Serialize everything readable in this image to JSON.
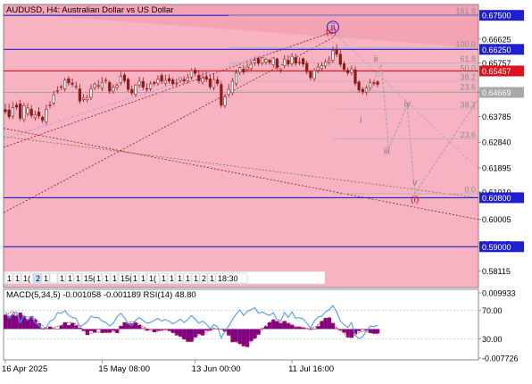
{
  "window": {
    "symbol_title": "AUDUSD, H4:  Australian Dollar vs US Dollar"
  },
  "colors": {
    "background": "#ffffff",
    "chart_area": "#f7b3c1",
    "channel_band": "#f4a3b4",
    "blue_line": "#1f1fd1",
    "red_line": "#e0111d",
    "candle": "#8b1a1a",
    "price_label_blue": "#1f1fd1",
    "price_label_red": "#e0111d",
    "price_label_grey": "#a8a8a8",
    "macd_hist": "#800080",
    "macd_signal": "#5599ee",
    "fib_text": "#8a8a8a",
    "wave_text": "#7a7a7a",
    "wave_blue": "#1f1fd1",
    "wave_red": "#e0111d",
    "projection": "#9f9fe6"
  },
  "chart_data": [
    {
      "type": "candlestick",
      "title": "AUDUSD, H4:  Australian Dollar vs US Dollar",
      "ylim": [
        0.575,
        0.679
      ],
      "y_ticks": [
        "0.66625",
        "0.65757",
        "0.64669",
        "0.63785",
        "0.62840",
        "0.61895",
        "0.61010",
        "0.60005",
        "0.59115",
        "0.58115"
      ],
      "x_tick_labels": [
        "16 Apr 2025",
        "15 May 08:00",
        "13 Jun 00:00",
        "11 Jul 16:00"
      ],
      "price_levels": [
        {
          "price": 0.675,
          "label": "0.67500",
          "style": "blue"
        },
        {
          "price": 0.6625,
          "label": "0.66250",
          "style": "blue"
        },
        {
          "price": 0.65457,
          "label": "0.65457",
          "style": "red"
        },
        {
          "price": 0.64669,
          "label": "0.64669",
          "style": "grey"
        },
        {
          "price": 0.608,
          "label": "0.60800",
          "style": "blue"
        },
        {
          "price": 0.59,
          "label": "0.59000",
          "style": "blue"
        }
      ],
      "fib_levels": [
        {
          "label": "161.8",
          "price": 0.675
        },
        {
          "label": "100.0",
          "price": 0.663
        },
        {
          "label": "61.8",
          "price": 0.6575
        },
        {
          "label": "50.0",
          "price": 0.654
        },
        {
          "label": "38.2",
          "price": 0.6508
        },
        {
          "label": "23.6",
          "price": 0.6472
        },
        {
          "label": "38.2",
          "price": 0.6406
        },
        {
          "label": "23.6",
          "price": 0.6297
        },
        {
          "label": "0.0",
          "price": 0.6095
        }
      ],
      "wave_labels": [
        {
          "text": "ii",
          "style": "circled-blue",
          "x": 88,
          "price": 0.6697
        },
        {
          "text": "(c)",
          "style": "red",
          "x": 87.5,
          "price": 0.668
        },
        {
          "text": "ii",
          "style": "grey",
          "x": 99.5,
          "price": 0.6578
        },
        {
          "text": "i",
          "style": "grey",
          "x": 95.5,
          "price": 0.6355
        },
        {
          "text": "iv",
          "style": "grey",
          "x": 108,
          "price": 0.6415
        },
        {
          "text": "iii",
          "style": "grey",
          "x": 102.5,
          "price": 0.624
        },
        {
          "text": "v",
          "style": "grey",
          "x": 110,
          "price": 0.6125
        },
        {
          "text": "(i)",
          "style": "red",
          "x": 110,
          "price": 0.6064
        }
      ],
      "wave_projection": [
        {
          "x": 97,
          "price": 0.645
        },
        {
          "x": 101,
          "price": 0.657
        },
        {
          "x": 103,
          "price": 0.626
        },
        {
          "x": 108,
          "price": 0.642
        },
        {
          "x": 110,
          "price": 0.6095
        },
        {
          "x": 127,
          "price": 0.644
        }
      ],
      "candles": [
        [
          0.6404,
          0.6396,
          0.6425
        ],
        [
          0.6402,
          0.6378,
          0.6425
        ],
        [
          0.638,
          0.6411,
          0.6432
        ],
        [
          0.642,
          0.6413,
          0.643
        ],
        [
          0.6425,
          0.6372,
          0.644
        ],
        [
          0.6368,
          0.6418,
          0.6428
        ],
        [
          0.639,
          0.6409,
          0.6427
        ],
        [
          0.6405,
          0.6382,
          0.642
        ],
        [
          0.6374,
          0.6385,
          0.64
        ],
        [
          0.6395,
          0.638,
          0.6413
        ],
        [
          0.6376,
          0.6364,
          0.6382
        ],
        [
          0.6358,
          0.6405,
          0.6422
        ],
        [
          0.6418,
          0.6421,
          0.6435
        ],
        [
          0.6428,
          0.6458,
          0.6473
        ],
        [
          0.6472,
          0.6474,
          0.649
        ],
        [
          0.6486,
          0.6488,
          0.6495
        ],
        [
          0.648,
          0.6512,
          0.652
        ],
        [
          0.6517,
          0.6502,
          0.6526
        ],
        [
          0.6501,
          0.6497,
          0.6518
        ],
        [
          0.6488,
          0.6489,
          0.6507
        ],
        [
          0.648,
          0.6435,
          0.6497
        ],
        [
          0.6441,
          0.6448,
          0.646
        ],
        [
          0.644,
          0.6448,
          0.6458
        ],
        [
          0.6449,
          0.6481,
          0.6496
        ],
        [
          0.6485,
          0.6497,
          0.6504
        ],
        [
          0.649,
          0.6493,
          0.6513
        ],
        [
          0.6482,
          0.6504,
          0.6523
        ],
        [
          0.651,
          0.6513,
          0.6521
        ],
        [
          0.6503,
          0.6472,
          0.6511
        ],
        [
          0.6472,
          0.6485,
          0.6497
        ],
        [
          0.6486,
          0.6493,
          0.6501
        ],
        [
          0.6503,
          0.6525,
          0.6543
        ],
        [
          0.6531,
          0.651,
          0.6539
        ],
        [
          0.6515,
          0.6478,
          0.6522
        ],
        [
          0.6478,
          0.6465,
          0.6491
        ],
        [
          0.646,
          0.6494,
          0.65
        ],
        [
          0.6494,
          0.6508,
          0.6524
        ],
        [
          0.6507,
          0.6486,
          0.6522
        ],
        [
          0.6481,
          0.6479,
          0.65
        ],
        [
          0.6481,
          0.6498,
          0.6508
        ],
        [
          0.6504,
          0.65,
          0.651
        ],
        [
          0.6501,
          0.6515,
          0.6529
        ],
        [
          0.6529,
          0.6508,
          0.6538
        ],
        [
          0.6501,
          0.6511,
          0.6532
        ],
        [
          0.6518,
          0.6509,
          0.6533
        ],
        [
          0.6513,
          0.6499,
          0.6522
        ],
        [
          0.6498,
          0.6501,
          0.6518
        ],
        [
          0.6511,
          0.6521,
          0.6522
        ],
        [
          0.6514,
          0.6509,
          0.6526
        ],
        [
          0.651,
          0.6521,
          0.6536
        ],
        [
          0.6523,
          0.6547,
          0.6556
        ],
        [
          0.6549,
          0.6537,
          0.6558
        ],
        [
          0.653,
          0.6509,
          0.6549
        ],
        [
          0.6505,
          0.652,
          0.6542
        ],
        [
          0.6524,
          0.6515,
          0.6543
        ],
        [
          0.6517,
          0.6487,
          0.6533
        ],
        [
          0.6484,
          0.6514,
          0.6536
        ],
        [
          0.6513,
          0.65,
          0.6526
        ],
        [
          0.6496,
          0.642,
          0.6509
        ],
        [
          0.6419,
          0.645,
          0.6459
        ],
        [
          0.6459,
          0.6478,
          0.6497
        ],
        [
          0.6466,
          0.6508,
          0.652
        ],
        [
          0.65,
          0.6538,
          0.6551
        ],
        [
          0.6541,
          0.6558,
          0.6562
        ],
        [
          0.6552,
          0.6542,
          0.6567
        ],
        [
          0.6552,
          0.6559,
          0.6573
        ],
        [
          0.6554,
          0.657,
          0.6581
        ],
        [
          0.6575,
          0.6585,
          0.6598
        ],
        [
          0.6591,
          0.6574,
          0.6599
        ],
        [
          0.6575,
          0.6594,
          0.6597
        ],
        [
          0.6578,
          0.6589,
          0.6594
        ],
        [
          0.6585,
          0.6578,
          0.6592
        ],
        [
          0.6568,
          0.6593,
          0.6597
        ],
        [
          0.659,
          0.6559,
          0.6594
        ],
        [
          0.6549,
          0.6554,
          0.6556
        ],
        [
          0.6565,
          0.6589,
          0.6604
        ],
        [
          0.6585,
          0.6571,
          0.6604
        ],
        [
          0.6573,
          0.6599,
          0.6612
        ],
        [
          0.6595,
          0.6574,
          0.661
        ],
        [
          0.6577,
          0.6578,
          0.6595
        ],
        [
          0.6591,
          0.6571,
          0.6595
        ],
        [
          0.6573,
          0.6543,
          0.6584
        ],
        [
          0.6543,
          0.6521,
          0.6548
        ],
        [
          0.6518,
          0.6547,
          0.6556
        ],
        [
          0.6548,
          0.656,
          0.6575
        ],
        [
          0.6554,
          0.6565,
          0.6578
        ],
        [
          0.6564,
          0.6579,
          0.6588
        ],
        [
          0.6578,
          0.6586,
          0.66
        ],
        [
          0.6586,
          0.662,
          0.6636
        ],
        [
          0.6624,
          0.6607,
          0.6644
        ],
        [
          0.6607,
          0.657,
          0.6622
        ],
        [
          0.6572,
          0.6552,
          0.6582
        ],
        [
          0.6548,
          0.6539,
          0.6558
        ],
        [
          0.654,
          0.6553,
          0.6566
        ],
        [
          0.655,
          0.65,
          0.6563
        ],
        [
          0.6505,
          0.6476,
          0.6511
        ],
        [
          0.6478,
          0.6469,
          0.6487
        ],
        [
          0.6468,
          0.6484,
          0.6493
        ],
        [
          0.6483,
          0.6502,
          0.6516
        ],
        [
          0.6503,
          0.65,
          0.6512
        ],
        [
          0.6505,
          0.6496,
          0.6511
        ]
      ]
    },
    {
      "type": "oscillator",
      "title": "MACD(5,34,5) -0.001058 -0.001189 RSI(14) 48.80",
      "y_ticks": [
        "0.009933",
        "70.00",
        "30.00",
        "-0.007726"
      ],
      "rsi_levels": [
        70,
        30
      ],
      "macd_range": [
        -0.007726,
        0.009933
      ],
      "macd": [
        0.0036,
        0.0033,
        0.0036,
        0.0033,
        0.0041,
        0.0033,
        0.0025,
        0.0032,
        0.0024,
        0.0014,
        0.0,
        0.0002,
        0.0006,
        0.0002,
        0.0001,
        0.0009,
        0.0017,
        0.001,
        0.0015,
        0.0009,
        0.0003,
        -0.0005,
        -0.0015,
        -0.0005,
        -0.0008,
        -0.0001,
        -0.001,
        -0.0009,
        -0.0009,
        -0.0004,
        -0.001,
        0.0008,
        0.0017,
        0.0014,
        0.0014,
        0.0016,
        0.001,
        0.0002,
        -0.0004,
        -0.0001,
        -0.0008,
        -0.0004,
        -0.0003,
        -0.0,
        -0.0005,
        -0.001,
        -0.0016,
        -0.0019,
        -0.0026,
        -0.0032,
        -0.0032,
        -0.0021,
        -0.0013,
        -0.0016,
        -0.0004,
        -0.0004,
        0.0002,
        0.0001,
        0.0,
        -0.0006,
        -0.0016,
        -0.0033,
        -0.0032,
        -0.0037,
        -0.0043,
        -0.0045,
        -0.003,
        -0.0024,
        -0.0014,
        0.0002,
        0.0007,
        0.0017,
        0.0024,
        0.0019,
        0.0015,
        0.002,
        0.0015,
        0.0011,
        0.0005,
        0.0006,
        0.0004,
        0.0002,
        -0.0002,
        0.0001,
        0.0007,
        0.002,
        0.0028,
        0.0029,
        0.0015,
        0.0002,
        -0.0003,
        -0.0009,
        -0.0021,
        -0.0022,
        -0.0012,
        -0.0005,
        -0.0001,
        -0.0004,
        -0.001,
        -0.0011,
        -0.0011
      ],
      "signal": [
        0.0034,
        0.004,
        0.0044,
        0.0034,
        0.0036,
        0.0032,
        0.003,
        0.0028,
        0.0026,
        0.0018,
        0.0008,
        0.0002,
        0.0,
        0.0004,
        0.0007,
        0.0009,
        0.0014,
        0.0017,
        0.0016,
        0.0012,
        0.0006,
        -0.0003,
        -0.001,
        -0.0011,
        -0.0009,
        -0.0008,
        -0.0007,
        -0.0009,
        -0.0009,
        -0.0007,
        -0.0003,
        0.0003,
        0.0012,
        0.0016,
        0.0019,
        0.0017,
        0.0012,
        0.0006,
        0.0001,
        -0.0003,
        -0.0006,
        -0.0006,
        -0.0004,
        -0.0002,
        -0.0003,
        -0.0007,
        -0.0012,
        -0.0019,
        -0.0025,
        -0.003,
        -0.0029,
        -0.0022,
        -0.0014,
        -0.0011,
        -0.0007,
        -0.0002,
        0.0001,
        0.0001,
        -0.0001,
        -0.0006,
        -0.0014,
        -0.0025,
        -0.0033,
        -0.0038,
        -0.0042,
        -0.0039,
        -0.0031,
        -0.0024,
        -0.0013,
        -0.0002,
        0.0009,
        0.0017,
        0.0021,
        0.002,
        0.0018,
        0.0016,
        0.0013,
        0.0009,
        0.0006,
        0.0005,
        0.0003,
        0.0001,
        0.0001,
        0.0004,
        0.0011,
        0.0019,
        0.0026,
        0.0024,
        0.0013,
        0.0003,
        -0.0004,
        -0.0011,
        -0.0018,
        -0.0019,
        -0.0015,
        -0.0009,
        -0.0005,
        -0.0006,
        -0.0009,
        -0.0012,
        -0.0012
      ],
      "rsi": [
        68,
        59,
        66,
        68,
        53,
        63,
        56,
        62,
        53,
        49,
        44,
        46,
        55,
        57,
        67,
        66,
        70,
        63,
        60,
        59,
        47,
        50,
        54,
        62,
        60,
        60,
        55,
        53,
        48,
        52,
        61,
        66,
        60,
        51,
        49,
        56,
        60,
        56,
        52,
        53,
        56,
        59,
        55,
        57,
        55,
        51,
        54,
        58,
        53,
        57,
        63,
        58,
        52,
        55,
        51,
        44,
        50,
        47,
        31,
        41,
        48,
        57,
        65,
        71,
        63,
        69,
        71,
        74,
        66,
        68,
        65,
        63,
        67,
        57,
        56,
        67,
        60,
        68,
        59,
        60,
        58,
        52,
        45,
        55,
        61,
        62,
        68,
        71,
        77,
        68,
        55,
        50,
        46,
        53,
        35,
        30,
        33,
        41,
        48,
        47,
        49
      ]
    }
  ],
  "time_scrollbar": {
    "cells": [
      "1",
      "1",
      "1(",
      "2",
      "1",
      "",
      "1",
      "1",
      "1",
      "15(",
      "1",
      "1",
      "1",
      "15(",
      "1",
      "1",
      "1(",
      "1",
      "1",
      "1",
      "1",
      "1",
      "2",
      "1",
      "18:30"
    ]
  }
}
